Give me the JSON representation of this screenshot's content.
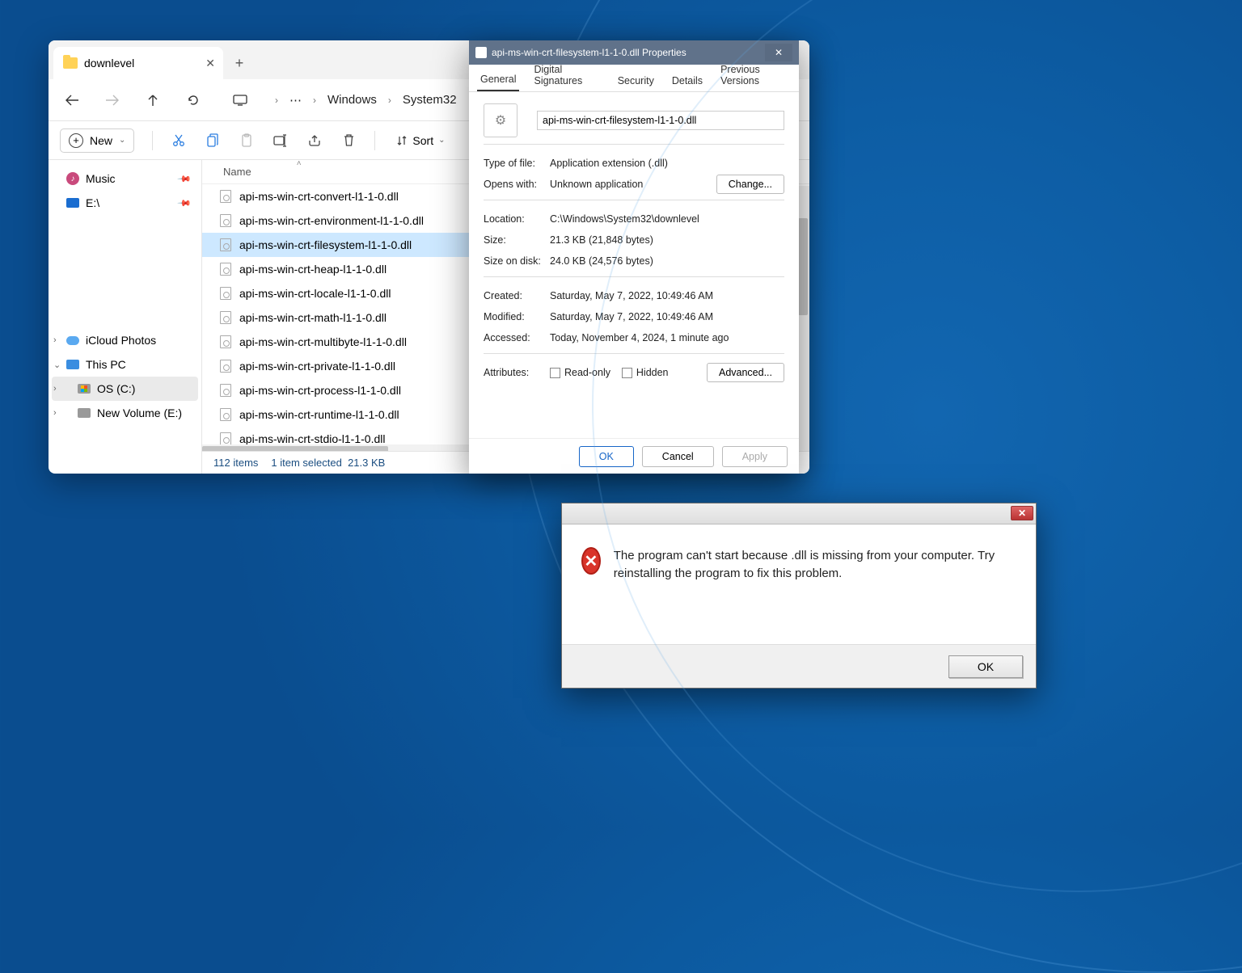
{
  "explorer": {
    "tab_title": "downlevel",
    "breadcrumb": [
      "Windows",
      "System32"
    ],
    "new_label": "New",
    "sort_label": "Sort",
    "column": "Name",
    "sidebar": {
      "top": [
        {
          "label": "Music",
          "icon": "music"
        },
        {
          "label": "E:\\",
          "icon": "drive"
        }
      ],
      "bottom": [
        {
          "label": "iCloud Photos",
          "icon": "cloud",
          "exp": ">"
        },
        {
          "label": "This PC",
          "icon": "pc",
          "exp": "v"
        },
        {
          "label": "OS (C:)",
          "icon": "disk-win",
          "exp": ">",
          "sel": true,
          "indent": 1
        },
        {
          "label": "New Volume (E:)",
          "icon": "disk",
          "exp": ">",
          "indent": 1
        }
      ]
    },
    "files": [
      "api-ms-win-crt-convert-l1-1-0.dll",
      "api-ms-win-crt-environment-l1-1-0.dll",
      "api-ms-win-crt-filesystem-l1-1-0.dll",
      "api-ms-win-crt-heap-l1-1-0.dll",
      "api-ms-win-crt-locale-l1-1-0.dll",
      "api-ms-win-crt-math-l1-1-0.dll",
      "api-ms-win-crt-multibyte-l1-1-0.dll",
      "api-ms-win-crt-private-l1-1-0.dll",
      "api-ms-win-crt-process-l1-1-0.dll",
      "api-ms-win-crt-runtime-l1-1-0.dll",
      "api-ms-win-crt-stdio-l1-1-0.dll"
    ],
    "selected_index": 2,
    "status": {
      "items": "112 items",
      "sel": "1 item selected",
      "size": "21.3 KB"
    }
  },
  "props": {
    "title": "api-ms-win-crt-filesystem-l1-1-0.dll Properties",
    "tabs": [
      "General",
      "Digital Signatures",
      "Security",
      "Details",
      "Previous Versions"
    ],
    "filename": "api-ms-win-crt-filesystem-l1-1-0.dll",
    "rows": {
      "type_label": "Type of file:",
      "type_val": "Application extension (.dll)",
      "opens_label": "Opens with:",
      "opens_val": "Unknown application",
      "change_btn": "Change...",
      "loc_label": "Location:",
      "loc_val": "C:\\Windows\\System32\\downlevel",
      "size_label": "Size:",
      "size_val": "21.3 KB (21,848 bytes)",
      "disk_label": "Size on disk:",
      "disk_val": "24.0 KB (24,576 bytes)",
      "created_label": "Created:",
      "created_val": "Saturday, May 7, 2022, 10:49:46 AM",
      "mod_label": "Modified:",
      "mod_val": "Saturday, May 7, 2022, 10:49:46 AM",
      "acc_label": "Accessed:",
      "acc_val": "Today, November 4, 2024, 1 minute ago",
      "attr_label": "Attributes:",
      "readonly": "Read-only",
      "hidden": "Hidden",
      "advanced": "Advanced..."
    },
    "footer": {
      "ok": "OK",
      "cancel": "Cancel",
      "apply": "Apply"
    }
  },
  "error": {
    "text": "The program can't start because         .dll is missing from your computer. Try reinstalling the program to fix this problem.",
    "ok": "OK"
  }
}
